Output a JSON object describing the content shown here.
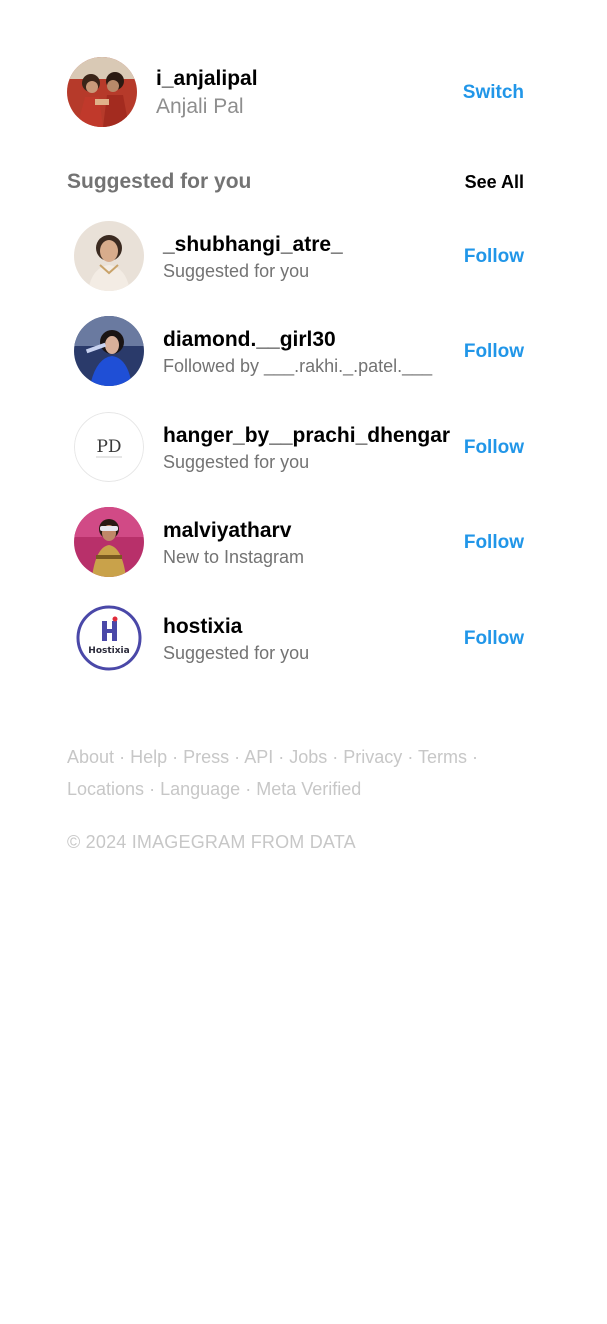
{
  "current_user": {
    "username": "i_anjalipal",
    "full_name": "Anjali Pal",
    "switch_label": "Switch"
  },
  "suggested": {
    "title": "Suggested for you",
    "see_all_label": "See All",
    "items": [
      {
        "username": "_shubhangi_atre_",
        "subtitle": "Suggested for you",
        "follow_label": "Follow"
      },
      {
        "username": "diamond.__girl30",
        "subtitle": "Followed by ___.rakhi._.patel.___",
        "follow_label": "Follow"
      },
      {
        "username": "hanger_by__prachi_dhengar",
        "subtitle": "Suggested for you",
        "follow_label": "Follow",
        "avatar_logo_text": "PD"
      },
      {
        "username": "malviyatharv",
        "subtitle": "New to Instagram",
        "follow_label": "Follow"
      },
      {
        "username": "hostixia",
        "subtitle": "Suggested for you",
        "follow_label": "Follow",
        "avatar_logo_text": "Hostixia"
      }
    ]
  },
  "footer": {
    "links": [
      "About",
      "Help",
      "Press",
      "API",
      "Jobs",
      "Privacy",
      "Terms",
      "Locations",
      "Language",
      "Meta Verified"
    ],
    "separator": "·",
    "copyright": "© 2024 IMAGEGRAM FROM DATA"
  },
  "colors": {
    "accent": "#2196e8",
    "muted": "#737373",
    "footer": "#c7c7c7"
  }
}
